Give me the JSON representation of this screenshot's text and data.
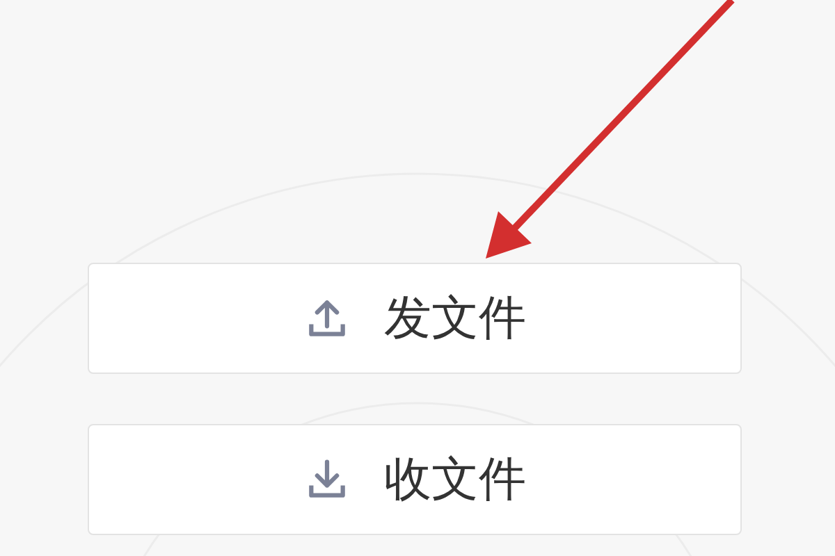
{
  "buttons": [
    {
      "kind": "upload",
      "label": "发文件"
    },
    {
      "kind": "download",
      "label": "收文件"
    }
  ]
}
